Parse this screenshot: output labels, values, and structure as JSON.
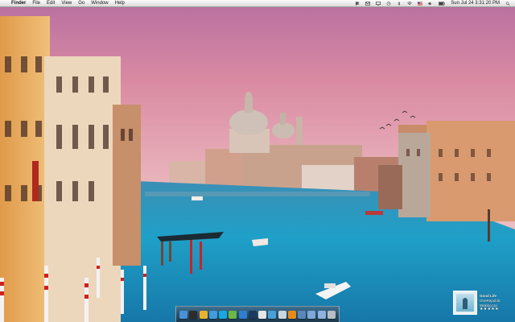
{
  "menubar": {
    "apple_glyph": "",
    "app_name": "Finder",
    "menus": [
      "File",
      "Edit",
      "View",
      "Go",
      "Window",
      "Help"
    ],
    "clock": "Sun Jul 24  3:31:20 PM",
    "status_icons": [
      "flag-icon",
      "mail-icon",
      "display-icon",
      "time-machine-icon",
      "bluetooth-icon",
      "wifi-icon",
      "flag-us-icon",
      "volume-icon",
      "battery-icon",
      "spotlight-icon"
    ]
  },
  "dock": {
    "icons": [
      {
        "name": "finder-icon",
        "color": "#4a90d9"
      },
      {
        "name": "dashboard-icon",
        "color": "#2c2c2c"
      },
      {
        "name": "chrome-icon",
        "color": "#e8b32c"
      },
      {
        "name": "safari-icon",
        "color": "#3f9de0"
      },
      {
        "name": "skype-icon",
        "color": "#18a7e0"
      },
      {
        "name": "utorrent-icon",
        "color": "#6bb846"
      },
      {
        "name": "appstore-icon",
        "color": "#2f7fd1"
      },
      {
        "name": "photoshop-icon",
        "color": "#1b3a5c"
      },
      {
        "name": "ical-icon",
        "color": "#e6e6e6"
      },
      {
        "name": "itunes-icon",
        "color": "#4b9fd6"
      },
      {
        "name": "preview-icon",
        "color": "#c9d6e0"
      },
      {
        "name": "vlc-icon",
        "color": "#e88a1a"
      },
      {
        "name": "xcode-icon",
        "color": "#5a86b8"
      },
      {
        "name": "applications-folder-icon",
        "color": "#7fa8d8"
      },
      {
        "name": "documents-folder-icon",
        "color": "#8fb3de"
      },
      {
        "name": "trash-icon",
        "color": "#b8bec4"
      }
    ]
  },
  "now_playing": {
    "song": "Good Life",
    "artist": "OneRepublic",
    "album": "Waking Up",
    "stars": "★★★★★"
  }
}
